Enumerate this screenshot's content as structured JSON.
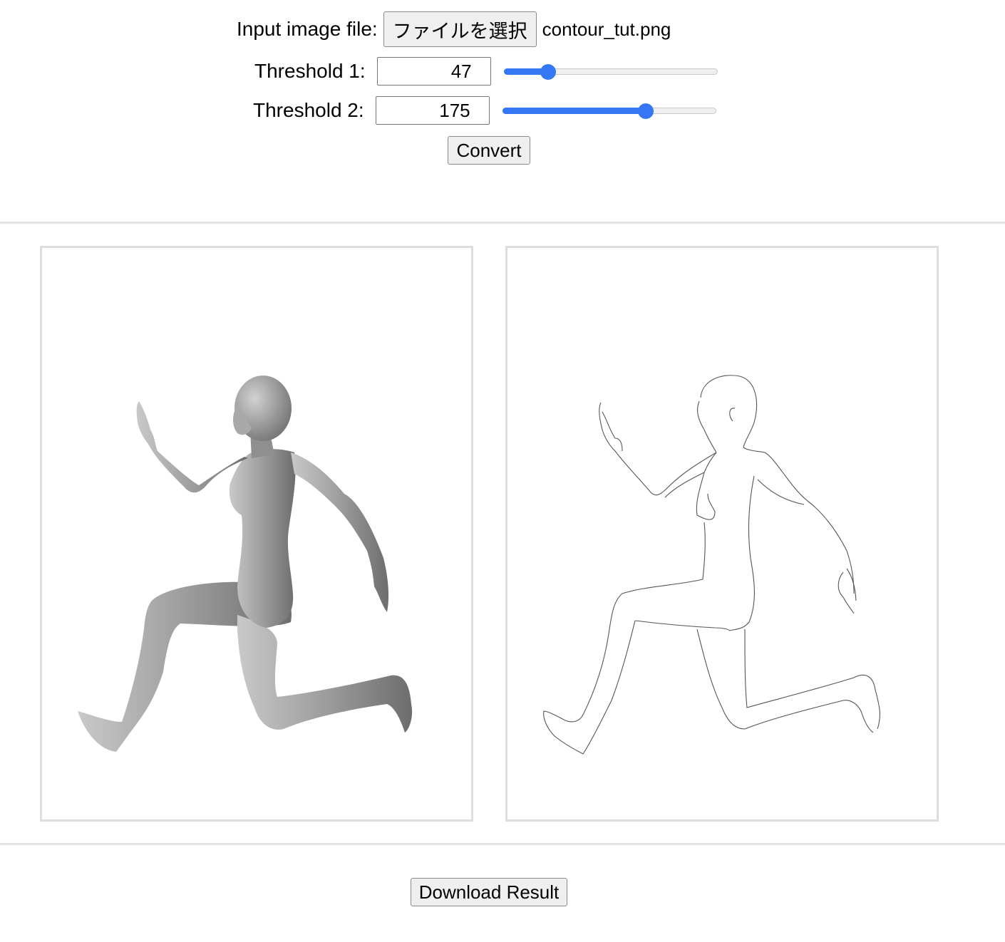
{
  "file_input": {
    "label": "Input image file:",
    "button_label": "ファイルを選択",
    "file_name": "contour_tut.png"
  },
  "threshold1": {
    "label": "Threshold 1:",
    "value": "47",
    "numeric_value": 47,
    "max": 255
  },
  "threshold2": {
    "label": "Threshold 2:",
    "value": "175",
    "numeric_value": 175,
    "max": 255
  },
  "convert_button": "Convert",
  "download_button": "Download Result",
  "colors": {
    "accent": "#3478f6",
    "panel_border": "#dedede",
    "divider": "#e3e3e3"
  }
}
